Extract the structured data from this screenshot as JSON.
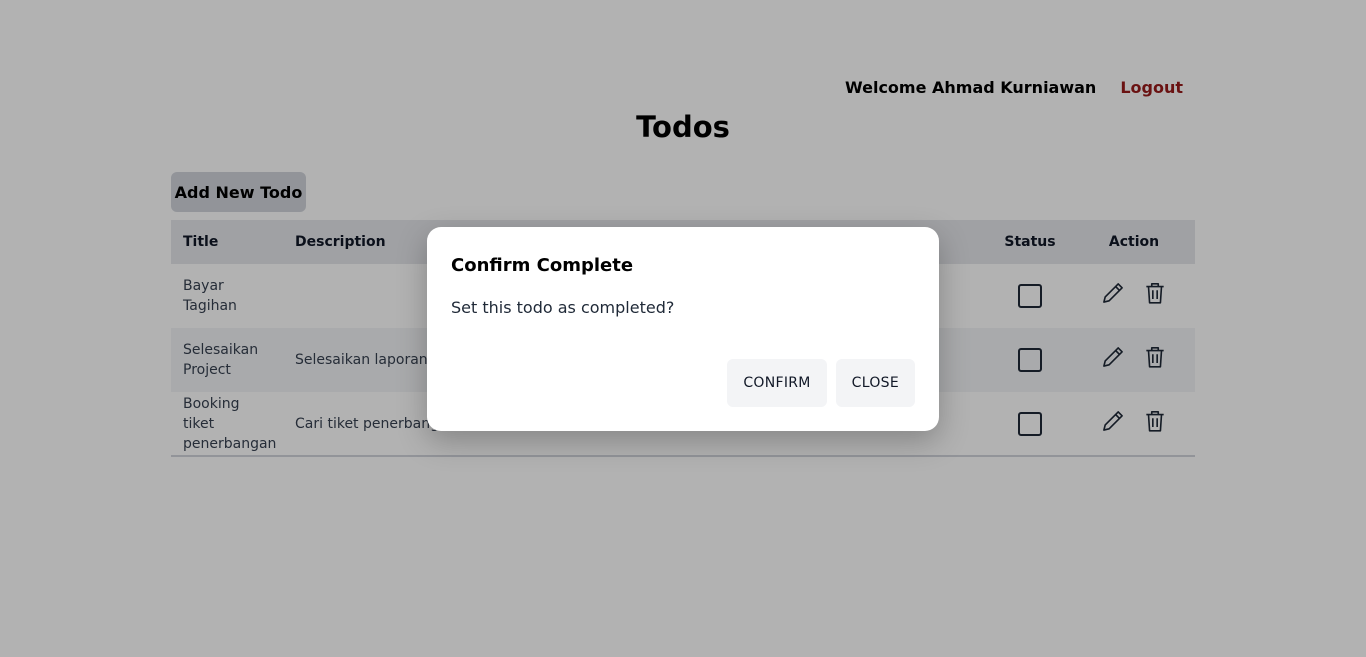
{
  "header": {
    "welcome_text": "Welcome Ahmad Kurniawan",
    "logout_label": "Logout"
  },
  "page_title": "Todos",
  "add_button_label": "Add New Todo",
  "table": {
    "columns": {
      "title": "Title",
      "description": "Description",
      "status": "Status",
      "action": "Action"
    },
    "rows": [
      {
        "title": "Bayar Tagihan",
        "description": ""
      },
      {
        "title": "Selesaikan Project",
        "description": "Selesaikan laporan ak"
      },
      {
        "title": "Booking tiket penerbangan",
        "description": "Cari tiket penerbangan"
      }
    ]
  },
  "modal": {
    "title": "Confirm Complete",
    "message": "Set this todo as completed?",
    "confirm_label": "CONFIRM",
    "close_label": "CLOSE"
  },
  "icons": {
    "edit": "pencil-icon",
    "delete": "trash-icon"
  },
  "colors": {
    "logout": "#991b1b",
    "overlay": "rgba(0,0,0,0.30)"
  }
}
